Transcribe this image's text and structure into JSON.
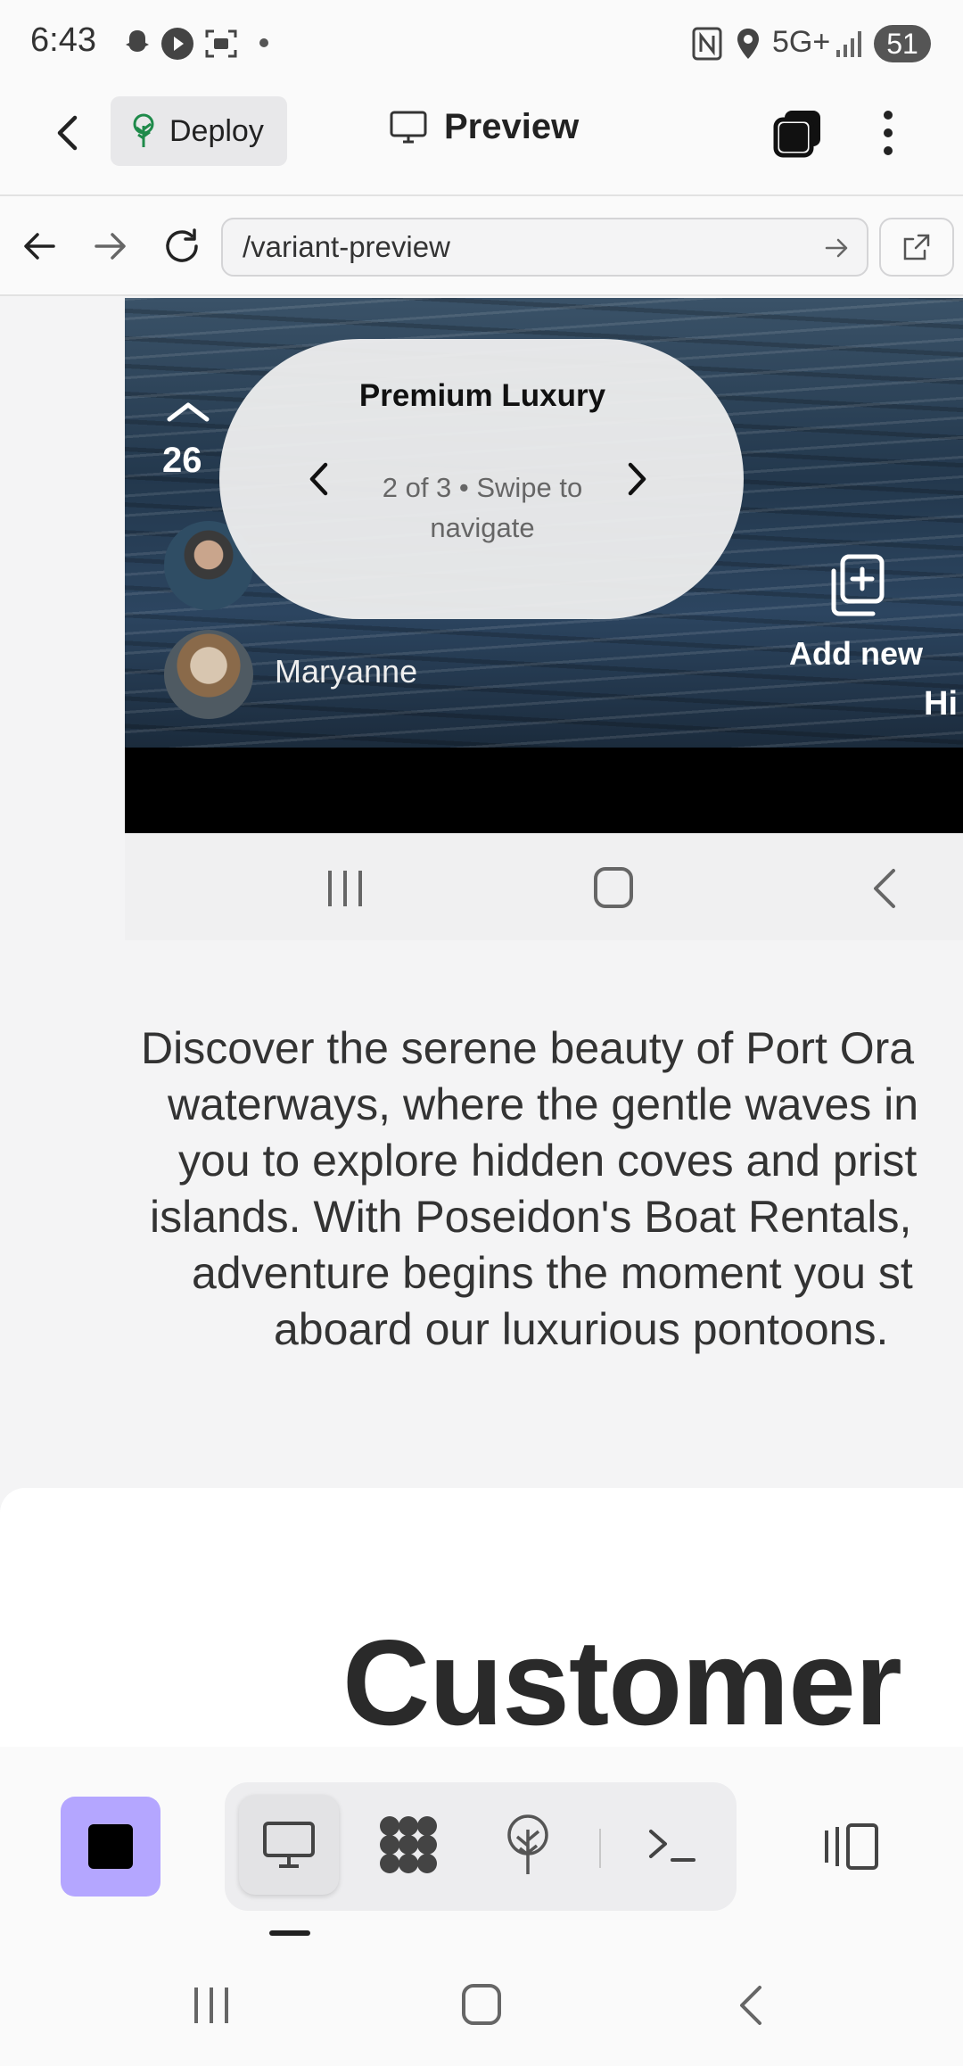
{
  "status_bar": {
    "time": "6:43",
    "network": "5G+",
    "battery": "51",
    "icons": [
      "snapchat-icon",
      "play-icon",
      "screenshot-icon",
      "dot-icon",
      "nfc-icon",
      "location-icon",
      "signal-icon"
    ]
  },
  "app_bar": {
    "deploy_label": "Deploy",
    "preview_label": "Preview"
  },
  "url_bar": {
    "url": "/variant-preview"
  },
  "preview": {
    "carousel": {
      "title": "Premium Luxury",
      "subtitle": "2 of 3 • Swipe to navigate"
    },
    "upvote_count": "26",
    "user_name": "Maryanne",
    "add_new_label": "Add new",
    "cut_label": "Hi"
  },
  "description": {
    "lines": [
      "Discover the serene beauty of Port Ora",
      "waterways, where the gentle waves in",
      "you to explore hidden coves and prist",
      "islands. With Poseidon's Boat Rentals,",
      "adventure begins the moment you st",
      "aboard our luxurious pontoons."
    ]
  },
  "section": {
    "heading": "Customer"
  },
  "colors": {
    "accent_stop": "#b4a6ff",
    "background": "#f4f4f5"
  }
}
